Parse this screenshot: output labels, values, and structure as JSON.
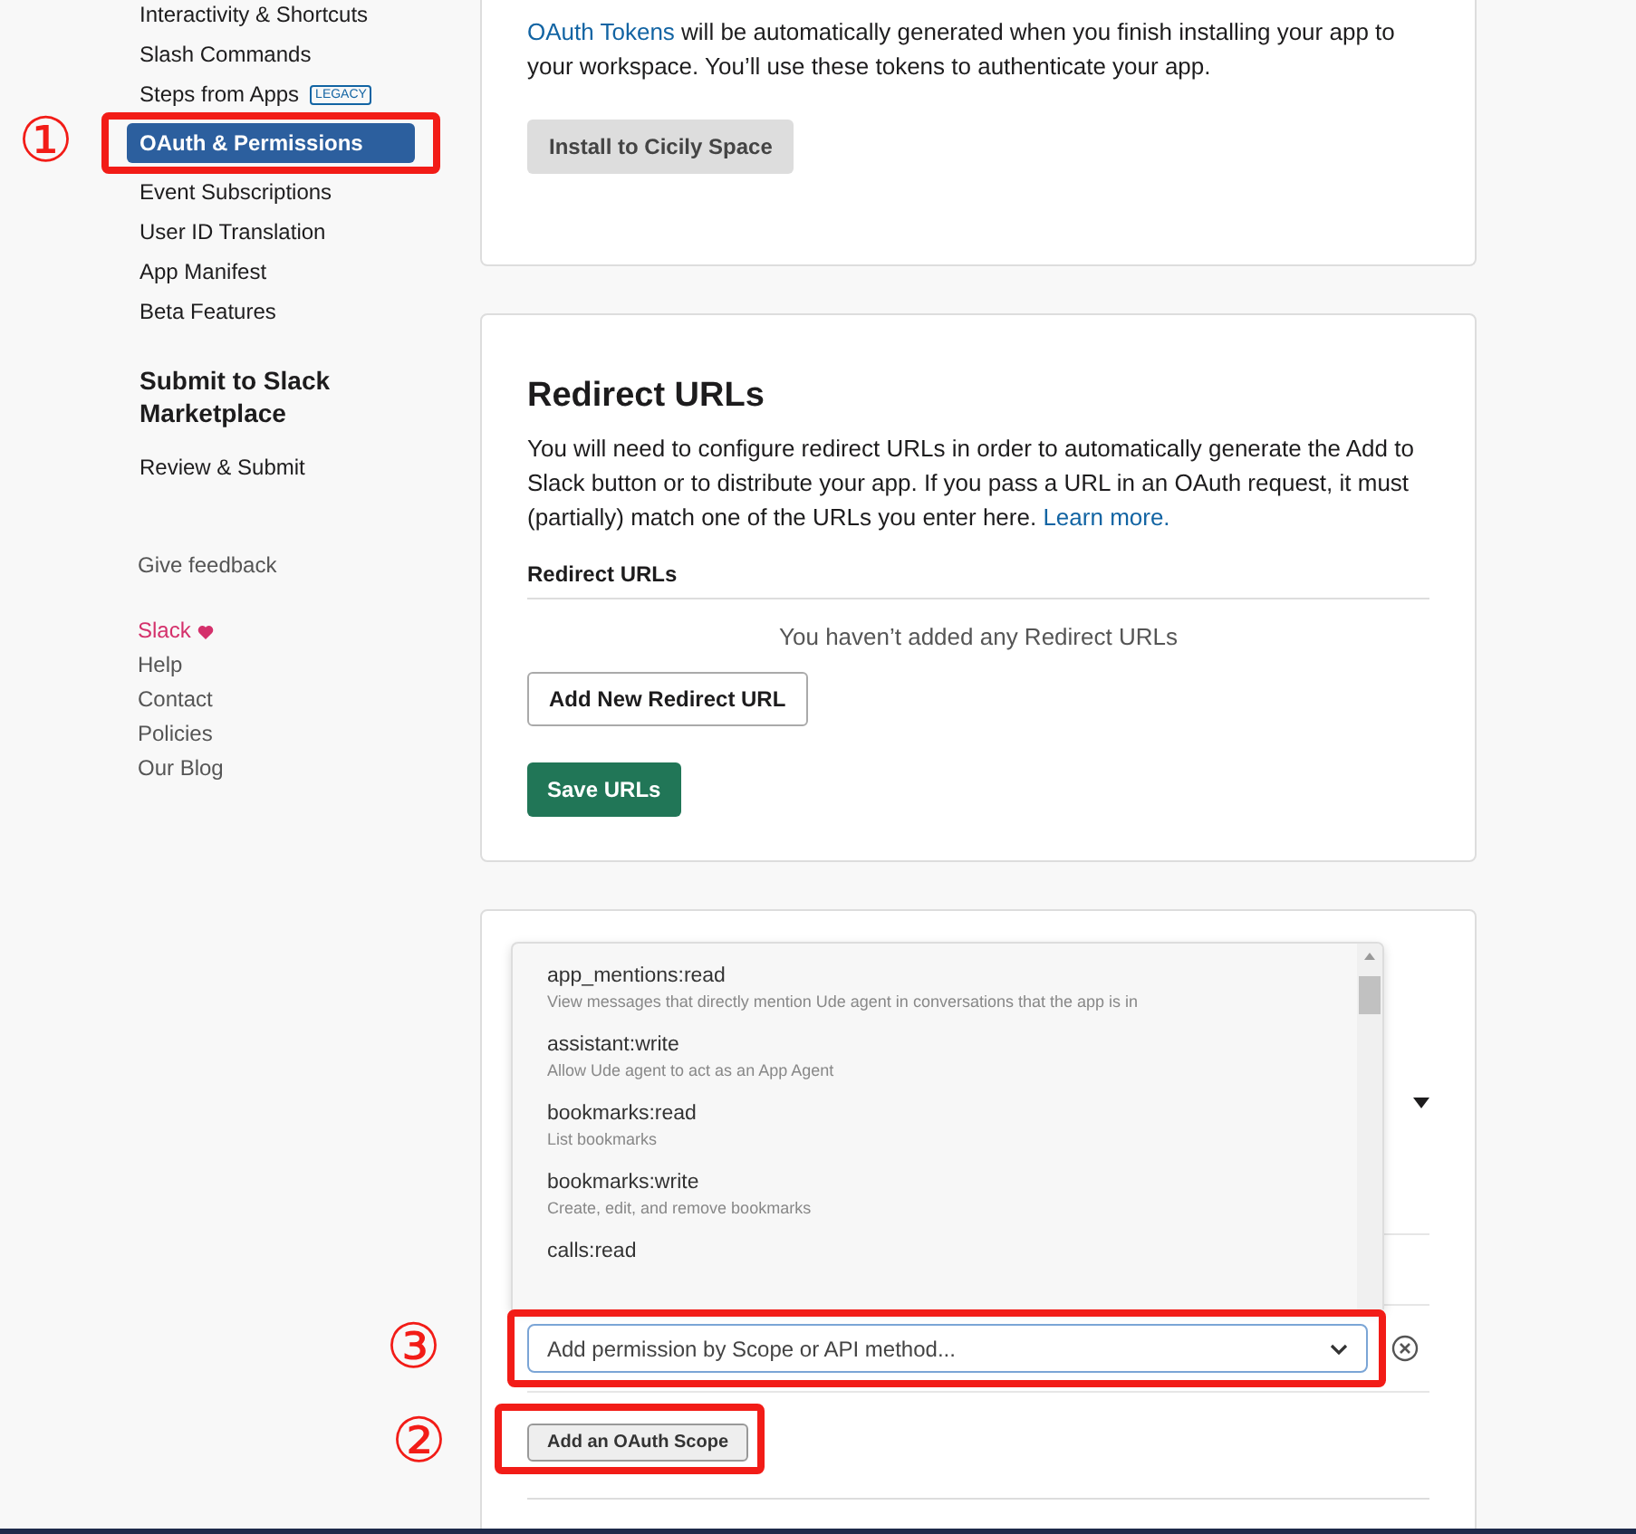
{
  "sidebar": {
    "nav_items": [
      {
        "label": "Interactivity & Shortcuts",
        "selected": false
      },
      {
        "label": "Slash Commands",
        "selected": false
      },
      {
        "label": "Steps from Apps",
        "selected": false,
        "badge": "LEGACY"
      },
      {
        "label": "OAuth & Permissions",
        "selected": true
      },
      {
        "label": "Event Subscriptions",
        "selected": false
      },
      {
        "label": "User ID Translation",
        "selected": false
      },
      {
        "label": "App Manifest",
        "selected": false
      },
      {
        "label": "Beta Features",
        "selected": false
      }
    ],
    "section_title": "Submit to Slack Marketplace",
    "section_items": [
      {
        "label": "Review & Submit",
        "selected": false
      }
    ],
    "feedback": "Give feedback",
    "footer_links": [
      {
        "label": "Slack",
        "kind": "brand"
      },
      {
        "label": "Help",
        "kind": "link"
      },
      {
        "label": "Contact",
        "kind": "link"
      },
      {
        "label": "Policies",
        "kind": "link"
      },
      {
        "label": "Our Blog",
        "kind": "link"
      }
    ]
  },
  "tokens_card": {
    "link": "OAuth Tokens",
    "text": " will be automatically generated when you finish installing your app to your workspace. You’ll use these tokens to authenticate your app.",
    "button": "Install to Cicily Space"
  },
  "redirect_card": {
    "title": "Redirect URLs",
    "description": "You will need to configure redirect URLs in order to automatically generate the Add to Slack button or to distribute your app. If you pass a URL in an OAuth request, it must (partially) match one of the URLs you enter here. ",
    "link": "Learn more.",
    "list_heading": "Redirect URLs",
    "empty_text": "You haven’t added any Redirect URLs",
    "add_button": "Add New Redirect URL",
    "save_button": "Save URLs"
  },
  "scopes_card": {
    "dropdown_options": [
      {
        "name": "app_mentions:read",
        "description": "View messages that directly mention Ude agent in conversations that the app is in"
      },
      {
        "name": "assistant:write",
        "description": "Allow Ude agent to act as an App Agent"
      },
      {
        "name": "bookmarks:read",
        "description": "List bookmarks"
      },
      {
        "name": "bookmarks:write",
        "description": "Create, edit, and remove bookmarks"
      },
      {
        "name": "calls:read"
      }
    ],
    "select_placeholder": "Add permission by Scope or API method...",
    "add_button": "Add an OAuth Scope"
  },
  "annotations": [
    {
      "number": "①"
    },
    {
      "number": "③"
    },
    {
      "number": "②"
    }
  ]
}
